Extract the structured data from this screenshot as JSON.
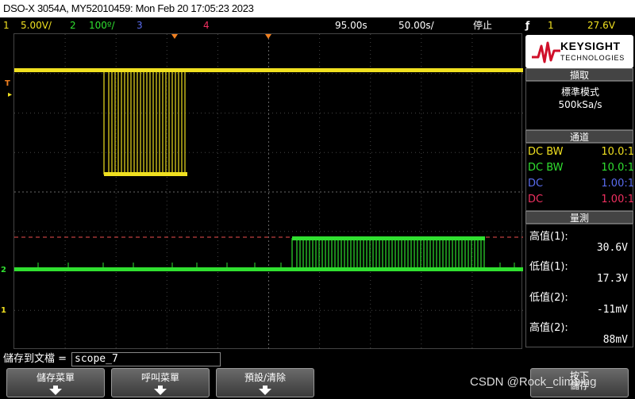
{
  "title": "DSO-X 3054A, MY52010459: Mon Feb 20 17:05:23 2023",
  "status": {
    "ch1_num": "1",
    "ch1_scale": "5.00V/",
    "ch2_num": "2",
    "ch2_scale": "100º/",
    "ch3_num": "3",
    "ch4_num": "4",
    "time_offset": "95.00s",
    "time_scale": "50.00s/",
    "run_state": "停止",
    "trigger_icon": "ƒ",
    "trigger_src": "1",
    "trigger_level": "27.6V"
  },
  "logo": {
    "brand": "KEYSIGHT",
    "sub": "TECHNOLOGIES"
  },
  "acquire": {
    "header": "擷取",
    "mode": "標準模式",
    "rate": "500kSa/s"
  },
  "channels": {
    "header": "通道",
    "rows": [
      {
        "coupling": "DC BW",
        "probe": "10.0:1",
        "color": "#f0e020"
      },
      {
        "coupling": "DC BW",
        "probe": "10.0:1",
        "color": "#30e030"
      },
      {
        "coupling": "DC",
        "probe": "1.00:1",
        "color": "#5a6cf0"
      },
      {
        "coupling": "DC",
        "probe": "1.00:1",
        "color": "#f03060"
      }
    ]
  },
  "measure": {
    "header": "量測",
    "items": [
      {
        "label": "高值(1):",
        "value": "30.6V"
      },
      {
        "label": "低值(1):",
        "value": "17.3V"
      },
      {
        "label": "低值(2):",
        "value": "-11mV"
      },
      {
        "label": "高值(2):",
        "value": "88mV"
      }
    ]
  },
  "markers": {
    "trigger": "T",
    "ch2": "2",
    "ch1": "1"
  },
  "file": {
    "label": "儲存到文檔 =",
    "name": "scope_7"
  },
  "softkeys": [
    {
      "label": "儲存菜單"
    },
    {
      "label": "呼叫菜單"
    },
    {
      "label": "預設/清除"
    },
    {
      "label": "按下\n儲存"
    }
  ],
  "watermark": "CSDN @Rock_climbing",
  "colors": {
    "ch1": "#f0e020",
    "ch2": "#30e030",
    "ch3": "#5a6cf0",
    "ch4": "#f03060",
    "trigger_marker": "#f08020"
  }
}
